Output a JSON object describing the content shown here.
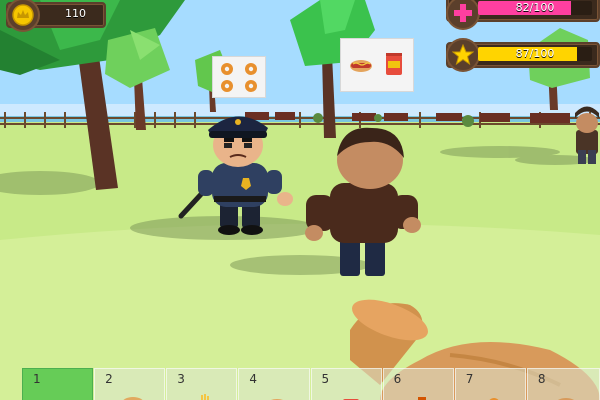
{
  "hud": {
    "coins": {
      "value": "110",
      "icon": "crown-coin-icon",
      "color": "#f6c600"
    },
    "health": {
      "value": "82/100",
      "fraction": 0.82,
      "icon": "plus-cross-icon",
      "color": "#ff3fa0"
    },
    "energy": {
      "value": "87/100",
      "fraction": 0.87,
      "icon": "star-icon",
      "color": "#ffd400"
    }
  },
  "bubbles": {
    "police": {
      "items": [
        "donut-icon",
        "donut-icon",
        "donut-icon",
        "donut-icon"
      ]
    },
    "customer": {
      "items": [
        "hotdog-icon",
        "chips-bag-icon"
      ]
    }
  },
  "hotbar": {
    "selected_index": 0,
    "slots": [
      {
        "number": "1",
        "item": ""
      },
      {
        "number": "2",
        "item": "bread-icon"
      },
      {
        "number": "3",
        "item": "fries-icon"
      },
      {
        "number": "4",
        "item": "hotdog-icon"
      },
      {
        "number": "5",
        "item": "chips-bag-icon"
      },
      {
        "number": "6",
        "item": "drink-icon"
      },
      {
        "number": "7",
        "item": "donut-icon"
      },
      {
        "number": "8",
        "item": "burger-icon"
      }
    ]
  },
  "colors": {
    "sky": "#9fd9ff",
    "grass": "#c7ea86",
    "panel": "#3b2a1d",
    "hotbar_selected": "#5ac850"
  }
}
